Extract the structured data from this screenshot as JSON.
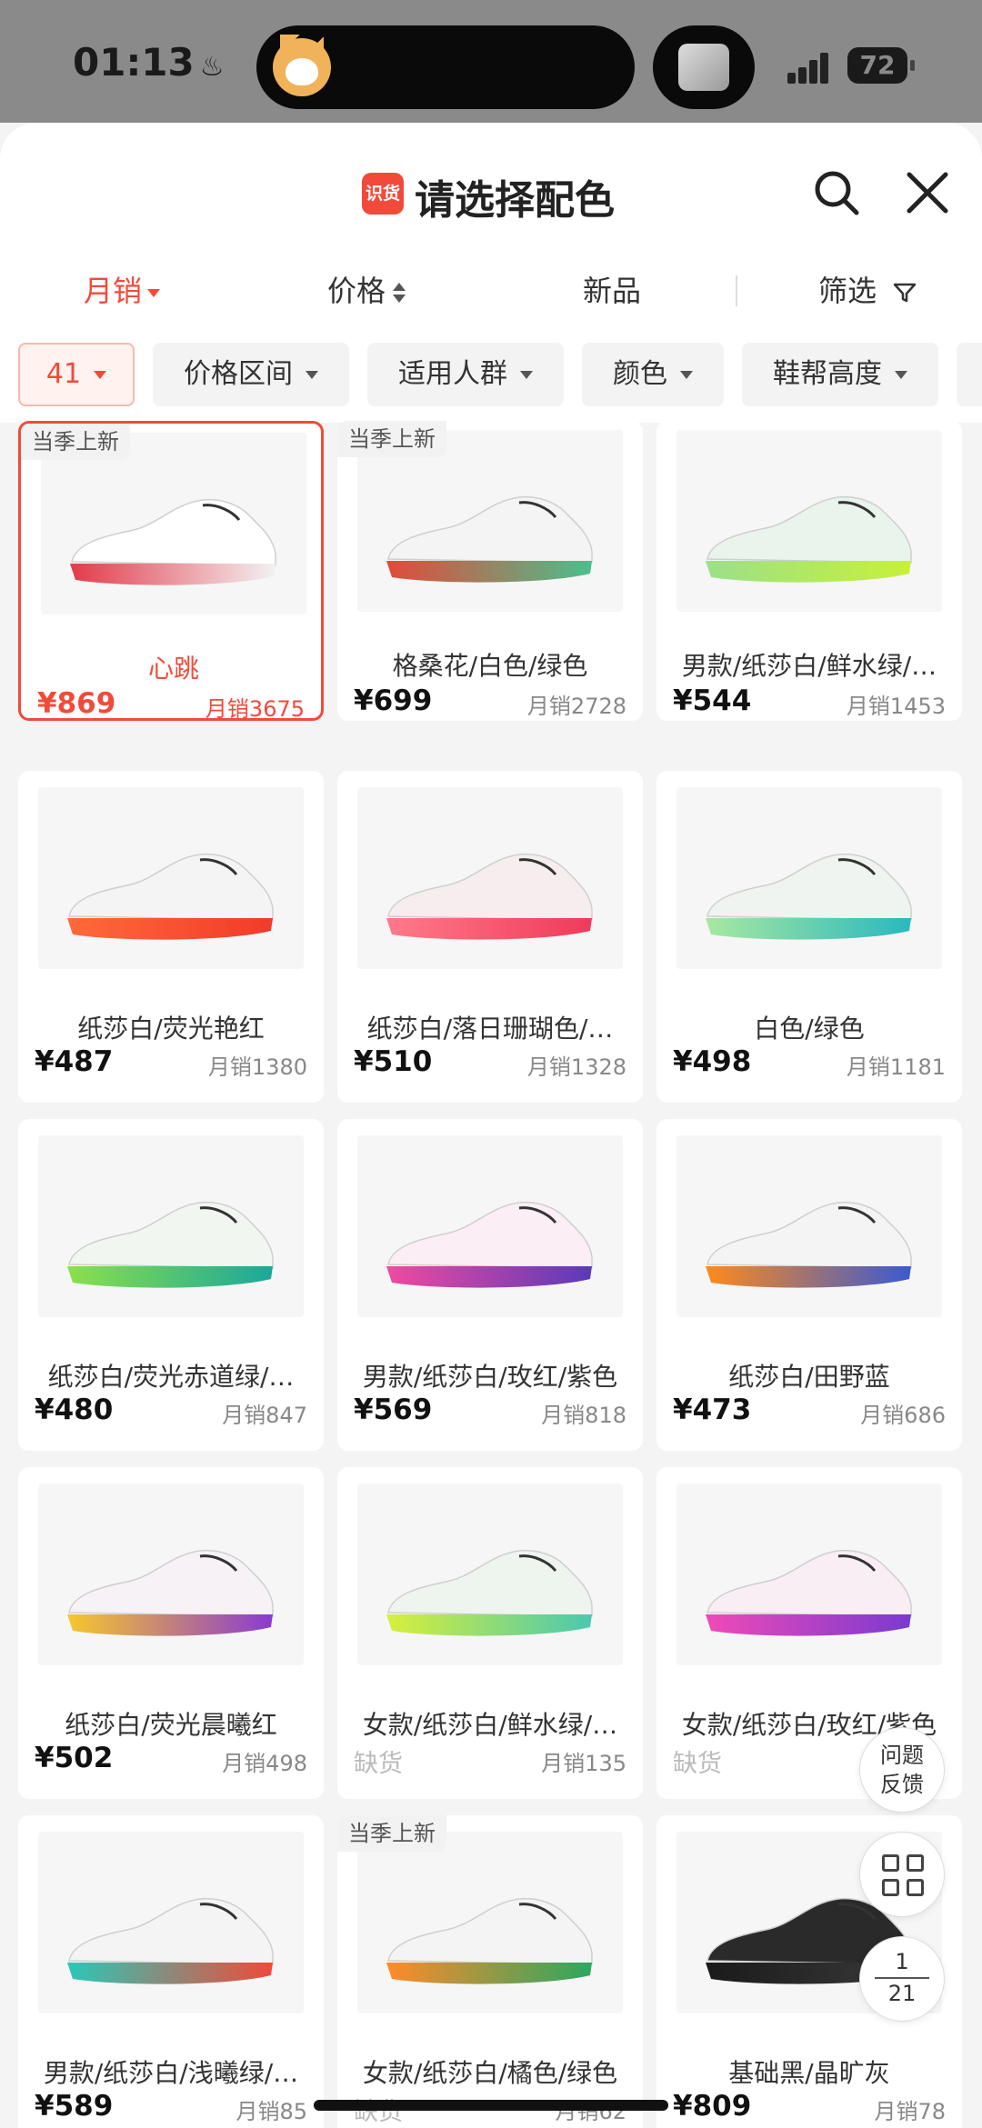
{
  "status_bar": {
    "time": "01:13",
    "battery": "72"
  },
  "header": {
    "brand_icon_text": "识货",
    "title": "请选择配色"
  },
  "sort_tabs": [
    {
      "label": "月销",
      "active": true
    },
    {
      "label": "价格"
    },
    {
      "label": "新品"
    },
    {
      "label": "筛选"
    }
  ],
  "filter_chips": [
    {
      "label": "41",
      "active": true
    },
    {
      "label": "价格区间"
    },
    {
      "label": "适用人群"
    },
    {
      "label": "颜色"
    },
    {
      "label": "鞋帮高度"
    }
  ],
  "products": [
    {
      "badge": "当季上新",
      "name": "心跳",
      "price": "¥869",
      "sales": "月销3675",
      "selected": true,
      "colors": [
        "#ffffff",
        "#e23a4a",
        "#f2f2f2"
      ]
    },
    {
      "badge": "当季上新",
      "name": "格桑花/白色/绿色",
      "price": "¥699",
      "sales": "月销2728",
      "colors": [
        "#f4f4f4",
        "#e24a3a",
        "#4bbf8c"
      ]
    },
    {
      "name": "男款/纸莎白/鲜水绿/…",
      "price": "¥544",
      "sales": "月销1453",
      "colors": [
        "#e8f4ec",
        "#9be08a",
        "#c8f03a"
      ]
    },
    {
      "name": "纸莎白/荧光艳红",
      "price": "¥487",
      "sales": "月销1380",
      "colors": [
        "#f4f4f4",
        "#ff6a3a",
        "#f23a2a"
      ]
    },
    {
      "name": "纸莎白/落日珊瑚色/…",
      "price": "¥510",
      "sales": "月销1328",
      "colors": [
        "#f6eeee",
        "#ff7a8a",
        "#f03a5a"
      ]
    },
    {
      "name": "白色/绿色",
      "price": "¥498",
      "sales": "月销1181",
      "colors": [
        "#f0f4f0",
        "#a8e8a0",
        "#2ab8c0"
      ]
    },
    {
      "name": "纸莎白/荧光赤道绿/…",
      "price": "¥480",
      "sales": "月销847",
      "colors": [
        "#f2f6f0",
        "#8ce04a",
        "#1aa89a"
      ]
    },
    {
      "name": "男款/纸莎白/玫红/紫色",
      "price": "¥569",
      "sales": "月销818",
      "colors": [
        "#fbeef4",
        "#f04aa0",
        "#5a3ab8"
      ]
    },
    {
      "name": "纸莎白/田野蓝",
      "price": "¥473",
      "sales": "月销686",
      "colors": [
        "#f4f4f4",
        "#ff8a1a",
        "#3a5ad0"
      ]
    },
    {
      "name": "纸莎白/荧光晨曦红",
      "price": "¥502",
      "sales": "月销498",
      "colors": [
        "#f6f2f6",
        "#f8c82a",
        "#8a3ad0"
      ]
    },
    {
      "name": "女款/纸莎白/鲜水绿/…",
      "price": "缺货",
      "sales": "月销135",
      "oos": true,
      "colors": [
        "#eef4ee",
        "#d8f03a",
        "#4ac8b0"
      ]
    },
    {
      "name": "女款/纸莎白/玫红/紫色",
      "price": "缺货",
      "sales": "月",
      "oos": true,
      "colors": [
        "#f8eef4",
        "#f04ab8",
        "#7a3ad0"
      ]
    },
    {
      "name": "男款/纸莎白/浅曦绿/…",
      "price": "¥589",
      "sales": "月销85",
      "colors": [
        "#f4f4f4",
        "#2ac8b8",
        "#f04a3a"
      ]
    },
    {
      "badge": "当季上新",
      "name": "女款/纸莎白/橘色/绿色",
      "price": "缺货",
      "sales": "月销62",
      "oos": true,
      "colors": [
        "#f4f4f4",
        "#ff8a2a",
        "#2aa860"
      ]
    },
    {
      "name": "基础黑/晶旷灰",
      "price": "¥809",
      "sales": "月销78",
      "colors": [
        "#2a2a2a",
        "#1a1a1a",
        "#3a3a3a"
      ]
    }
  ],
  "floating": {
    "feedback_line1": "问题",
    "feedback_line2": "反馈",
    "page_current": "1",
    "page_total": "21"
  }
}
